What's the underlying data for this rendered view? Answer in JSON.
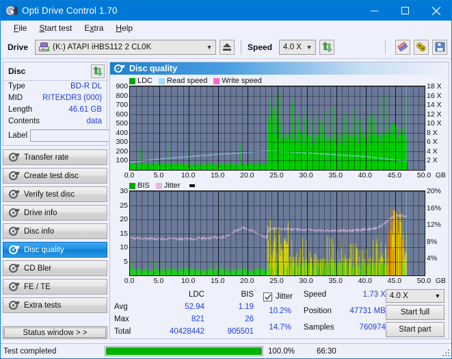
{
  "window": {
    "title": "Opti Drive Control 1.70",
    "icon": "disc-icon",
    "minimize": "minimize",
    "maximize": "maximize",
    "close": "close"
  },
  "menu": [
    {
      "label": "File",
      "accel": "F"
    },
    {
      "label": "Start test",
      "accel": "S"
    },
    {
      "label": "Extra",
      "accel": "x"
    },
    {
      "label": "Help",
      "accel": "H"
    }
  ],
  "toolbar": {
    "drive_label": "Drive",
    "drive_value": "(K:)  ATAPI iHBS112  2 CL0K",
    "eject_icon": "eject-icon",
    "speed_label": "Speed",
    "speed_value": "4.0 X",
    "refresh_icon": "refresh-icon",
    "eraser_icon": "eraser-icon",
    "plug_icon": "plug-icon",
    "save_icon": "save-icon"
  },
  "disc": {
    "title": "Disc",
    "refresh_icon": "refresh-icon",
    "fields": [
      {
        "key": "Type",
        "value": "BD-R DL"
      },
      {
        "key": "MID",
        "value": "RITEKDR3 (000)"
      },
      {
        "key": "Length",
        "value": "46.61 GB"
      },
      {
        "key": "Contents",
        "value": "data"
      }
    ],
    "label_key": "Label",
    "label_value": "",
    "label_placeholder": "",
    "cd_icon": "cd-icon"
  },
  "nav": {
    "items": [
      {
        "label": "Transfer rate",
        "selected": false
      },
      {
        "label": "Create test disc",
        "selected": false
      },
      {
        "label": "Verify test disc",
        "selected": false
      },
      {
        "label": "Drive info",
        "selected": false
      },
      {
        "label": "Disc info",
        "selected": false
      },
      {
        "label": "Disc quality",
        "selected": true
      },
      {
        "label": "CD Bler",
        "selected": false
      },
      {
        "label": "FE / TE",
        "selected": false
      },
      {
        "label": "Extra tests",
        "selected": false
      }
    ],
    "status_window": "Status window > >"
  },
  "panel": {
    "title": "Disc quality",
    "icon": "disc-quality-icon"
  },
  "stats": {
    "col_headers": [
      "",
      "LDC",
      "BIS"
    ],
    "rows": [
      {
        "label": "Avg",
        "ldc": "52.94",
        "bis": "1.19"
      },
      {
        "label": "Max",
        "ldc": "821",
        "bis": "26"
      },
      {
        "label": "Total",
        "ldc": "40428442",
        "bis": "905501"
      }
    ],
    "jitter_label": "Jitter",
    "jitter_checked": true,
    "jitter_avg": "10.2%",
    "jitter_max": "14.7%",
    "speed_label": "Speed",
    "speed_value": "1.73 X",
    "position_label": "Position",
    "position_value": "47731 MB",
    "samples_label": "Samples",
    "samples_value": "760974",
    "speed_select": "4.0 X",
    "start_full": "Start full",
    "start_part": "Start part"
  },
  "statusbar": {
    "text": "Test completed",
    "percent": "100.0%",
    "progress": 100,
    "time": "66:30"
  },
  "colors": {
    "accent": "#0078d7",
    "plot_bg": "#6b7a99",
    "ldc": "#00cc00",
    "bis": "#00cc00",
    "bis_hi": "#cccc00",
    "bis_hi2": "#e08800",
    "read_speed": "#9fdcf5",
    "write_speed": "#ff66cc",
    "jitter": "#e0b8e0",
    "value_blue": "#1d3fd4",
    "progress_green": "#00b200"
  },
  "chart_data": [
    {
      "id": "ldc-chart",
      "type": "bar",
      "title": "",
      "xlabel": "GB",
      "ylabel": "LDC",
      "xlim": [
        0,
        50
      ],
      "ylim": [
        0,
        900
      ],
      "y2lim": [
        0,
        18
      ],
      "y2label": "X",
      "grid": true,
      "legend_position": "top-left",
      "legend": [
        {
          "name": "LDC",
          "color": "#00a400",
          "type": "bar"
        },
        {
          "name": "Read speed",
          "color": "#9fdcf5",
          "type": "line"
        },
        {
          "name": "Write speed",
          "color": "#ff66cc",
          "type": "line"
        }
      ],
      "xticks": [
        "0.0",
        "5.0",
        "10.0",
        "15.0",
        "20.0",
        "25.0",
        "30.0",
        "35.0",
        "40.0",
        "45.0",
        "50.0"
      ],
      "yticks": [
        100,
        200,
        300,
        400,
        500,
        600,
        700,
        800,
        900
      ],
      "y2ticks": [
        "2 X",
        "4 X",
        "6 X",
        "8 X",
        "10 X",
        "12 X",
        "14 X",
        "16 X",
        "18 X"
      ],
      "series": [
        {
          "name": "LDC",
          "color": "#00cc00",
          "note": "dense per-GB error bars; low baseline ~40-90 from 0-23GB with occasional spikes to 150-350; dense high region 23-47GB baseline 250-400 with peaks to 830",
          "x_start": 0.0,
          "x_end": 47.0,
          "baseline_low": 60,
          "baseline_high": 330,
          "transition_gb": 23.3,
          "max": 821,
          "avg": 52.94,
          "total": 40428442
        },
        {
          "name": "Read speed",
          "color": "#9fdcf5",
          "note": "rises from ~2X at 0GB to ~4.3X near 23GB then gradually falls to ~2X at 47GB; vertical spike to 18X at 47GB",
          "points": [
            {
              "gb": 0.0,
              "x": 1.9
            },
            {
              "gb": 5.0,
              "x": 2.6
            },
            {
              "gb": 10.0,
              "x": 3.1
            },
            {
              "gb": 15.0,
              "x": 3.6
            },
            {
              "gb": 20.0,
              "x": 4.0
            },
            {
              "gb": 23.3,
              "x": 4.3
            },
            {
              "gb": 25.0,
              "x": 4.2
            },
            {
              "gb": 30.0,
              "x": 3.9
            },
            {
              "gb": 35.0,
              "x": 3.5
            },
            {
              "gb": 40.0,
              "x": 3.1
            },
            {
              "gb": 45.0,
              "x": 2.4
            },
            {
              "gb": 47.0,
              "x": 2.1
            }
          ]
        },
        {
          "name": "Write speed",
          "color": "#ff66cc",
          "points": []
        }
      ]
    },
    {
      "id": "bis-jitter-chart",
      "type": "bar",
      "title": "",
      "xlabel": "GB",
      "ylabel": "BIS",
      "xlim": [
        0,
        50
      ],
      "ylim": [
        0,
        30
      ],
      "y2lim": [
        0,
        20
      ],
      "y2label": "%",
      "grid": true,
      "legend_position": "top-left",
      "legend": [
        {
          "name": "BIS",
          "color": "#00a400",
          "type": "bar"
        },
        {
          "name": "Jitter",
          "color": "#e0b8e0",
          "type": "line"
        }
      ],
      "xticks": [
        "0.0",
        "5.0",
        "10.0",
        "15.0",
        "20.0",
        "25.0",
        "30.0",
        "35.0",
        "40.0",
        "45.0",
        "50.0"
      ],
      "yticks": [
        5,
        10,
        15,
        20,
        25,
        30
      ],
      "y2ticks": [
        "4%",
        "8%",
        "12%",
        "16%",
        "20%"
      ],
      "series": [
        {
          "name": "BIS",
          "color": "#00cc00",
          "note": "green low bars 0-23GB baseline ~1.5-3 with spikes to 6; yellow/olive denser region 23-47GB baseline 3-8 with spikes to 17-21; orange cluster near 44-46GB reaching 26",
          "x_start": 0.0,
          "x_end": 47.0,
          "max": 26,
          "avg": 1.19,
          "total": 905501,
          "transition_gb": 23.3
        },
        {
          "name": "Jitter",
          "color": "#e0b8e0",
          "note": "percent on right axis; ~9% at 0GB, dips ~8.7% near 12GB, rises to ~11.7% at 19GB, dips ~9.3% at 23GB, then ~11% plateau 24-40GB, rising to ~14.7% at 45GB",
          "avg_percent": 10.2,
          "max_percent": 14.7,
          "points": [
            {
              "gb": 0.0,
              "pct": 9.0
            },
            {
              "gb": 5.0,
              "pct": 8.9
            },
            {
              "gb": 10.0,
              "pct": 8.8
            },
            {
              "gb": 13.0,
              "pct": 9.0
            },
            {
              "gb": 16.0,
              "pct": 9.3
            },
            {
              "gb": 19.0,
              "pct": 11.5
            },
            {
              "gb": 21.0,
              "pct": 10.6
            },
            {
              "gb": 23.2,
              "pct": 9.2
            },
            {
              "gb": 23.6,
              "pct": 11.2
            },
            {
              "gb": 28.0,
              "pct": 11.1
            },
            {
              "gb": 33.0,
              "pct": 10.8
            },
            {
              "gb": 38.0,
              "pct": 10.8
            },
            {
              "gb": 42.0,
              "pct": 11.4
            },
            {
              "gb": 45.0,
              "pct": 14.3
            },
            {
              "gb": 47.0,
              "pct": 14.1
            }
          ]
        }
      ]
    }
  ]
}
